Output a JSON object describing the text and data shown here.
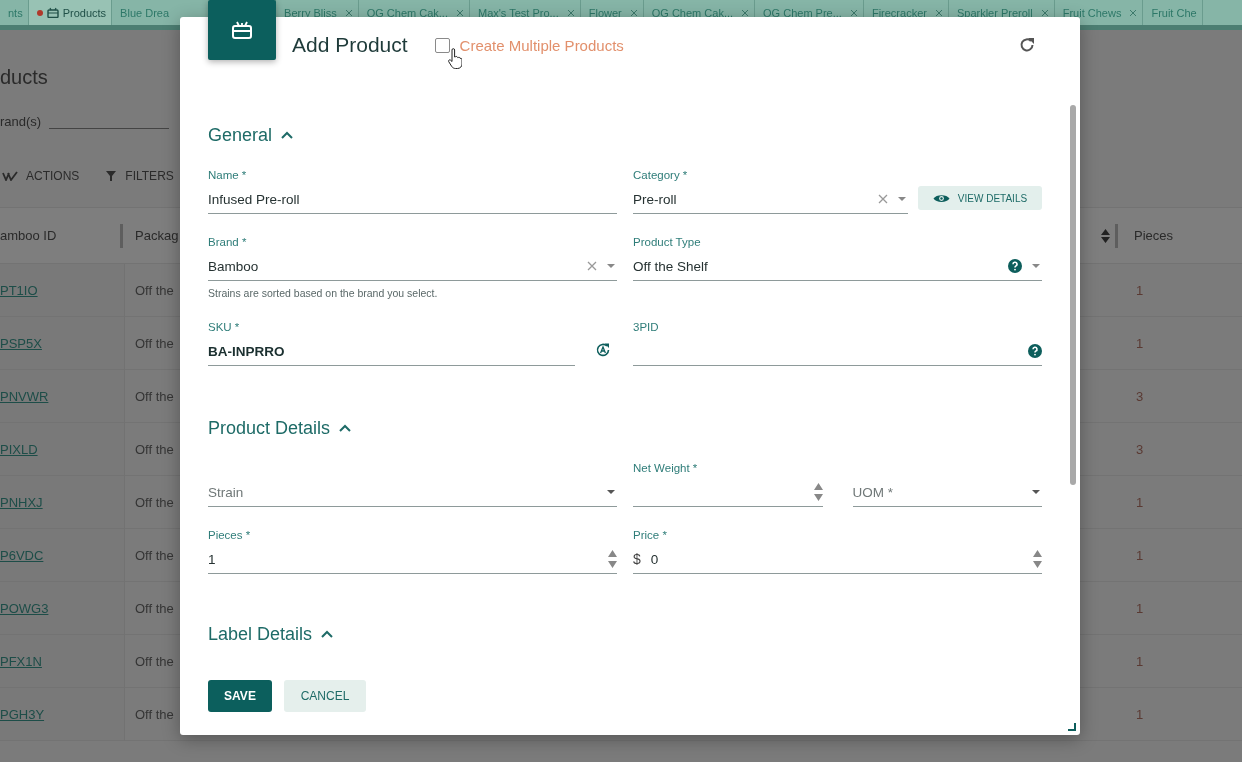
{
  "tabs": [
    {
      "label": "nts",
      "selected": false,
      "modified": false,
      "icon": false,
      "closable": false
    },
    {
      "label": "Products",
      "selected": true,
      "modified": true,
      "icon": true,
      "closable": false
    },
    {
      "label": "Blue Drea",
      "selected": false,
      "modified": false,
      "icon": false,
      "closable": false
    },
    {
      "label": "Berry Bliss",
      "selected": false,
      "modified": false,
      "icon": false,
      "closable": true
    },
    {
      "label": "OG Chem Cak...",
      "selected": false,
      "modified": false,
      "icon": false,
      "closable": true
    },
    {
      "label": "Max's Test Pro...",
      "selected": false,
      "modified": false,
      "icon": false,
      "closable": true
    },
    {
      "label": "Flower",
      "selected": false,
      "modified": false,
      "icon": false,
      "closable": true
    },
    {
      "label": "OG Chem Cak...",
      "selected": false,
      "modified": false,
      "icon": false,
      "closable": true
    },
    {
      "label": "OG Chem Pre...",
      "selected": false,
      "modified": false,
      "icon": false,
      "closable": true
    },
    {
      "label": "Firecracker",
      "selected": false,
      "modified": false,
      "icon": false,
      "closable": true
    },
    {
      "label": "Sparkler Preroll",
      "selected": false,
      "modified": false,
      "icon": false,
      "closable": true
    },
    {
      "label": "Fruit Chews",
      "selected": false,
      "modified": false,
      "icon": false,
      "closable": true
    },
    {
      "label": "Fruit Che",
      "selected": false,
      "modified": false,
      "icon": false,
      "closable": false
    }
  ],
  "page": {
    "title": "ducts",
    "filter_label": "rand(s)",
    "toolbar": [
      "ACTIONS",
      "FILTERS"
    ],
    "table": {
      "columns": [
        "amboo ID",
        "Packag",
        "Pieces"
      ],
      "rows": [
        {
          "id": "PT1IO",
          "package": "Off the",
          "pieces": "1"
        },
        {
          "id": "PSP5X",
          "package": "Off the",
          "pieces": "1"
        },
        {
          "id": "PNVWR",
          "package": "Off the",
          "pieces": "3"
        },
        {
          "id": "PIXLD",
          "package": "Off the",
          "pieces": "3"
        },
        {
          "id": "PNHXJ",
          "package": "Off the",
          "pieces": "1"
        },
        {
          "id": "P6VDC",
          "package": "Off the",
          "pieces": "1"
        },
        {
          "id": "POWG3",
          "package": "Off the",
          "pieces": "1"
        },
        {
          "id": "PFX1N",
          "package": "Off the",
          "pieces": "1"
        },
        {
          "id": "PGH3Y",
          "package": "Off the",
          "pieces": "1"
        }
      ]
    }
  },
  "dialog": {
    "title": "Add Product",
    "create_multiple": {
      "label": "Create Multiple Products",
      "checked": false
    },
    "general": {
      "title": "General",
      "expanded": true,
      "name": {
        "label": "Name *",
        "value": "Infused Pre-roll"
      },
      "category": {
        "label": "Category *",
        "value": "Pre-roll"
      },
      "view_details": "VIEW DETAILS",
      "brand": {
        "label": "Brand *",
        "value": "Bamboo",
        "hint": "Strains are sorted based on the brand you select."
      },
      "product_type": {
        "label": "Product Type",
        "value": "Off the Shelf"
      },
      "sku": {
        "label": "SKU *",
        "value": "BA-INPRRO"
      },
      "third_party_id": {
        "label": "3PID"
      }
    },
    "product_details": {
      "title": "Product Details",
      "expanded": true,
      "strain": {
        "placeholder": "Strain"
      },
      "net_weight": {
        "label": "Net Weight *"
      },
      "uom": {
        "placeholder": "UOM *"
      },
      "pieces": {
        "label": "Pieces *",
        "value": "1"
      },
      "price": {
        "label": "Price *",
        "prefix": "$",
        "value": "0"
      }
    },
    "label_details": {
      "title": "Label Details",
      "expanded": true
    },
    "buttons": [
      "SAVE",
      "CANCEL"
    ]
  }
}
